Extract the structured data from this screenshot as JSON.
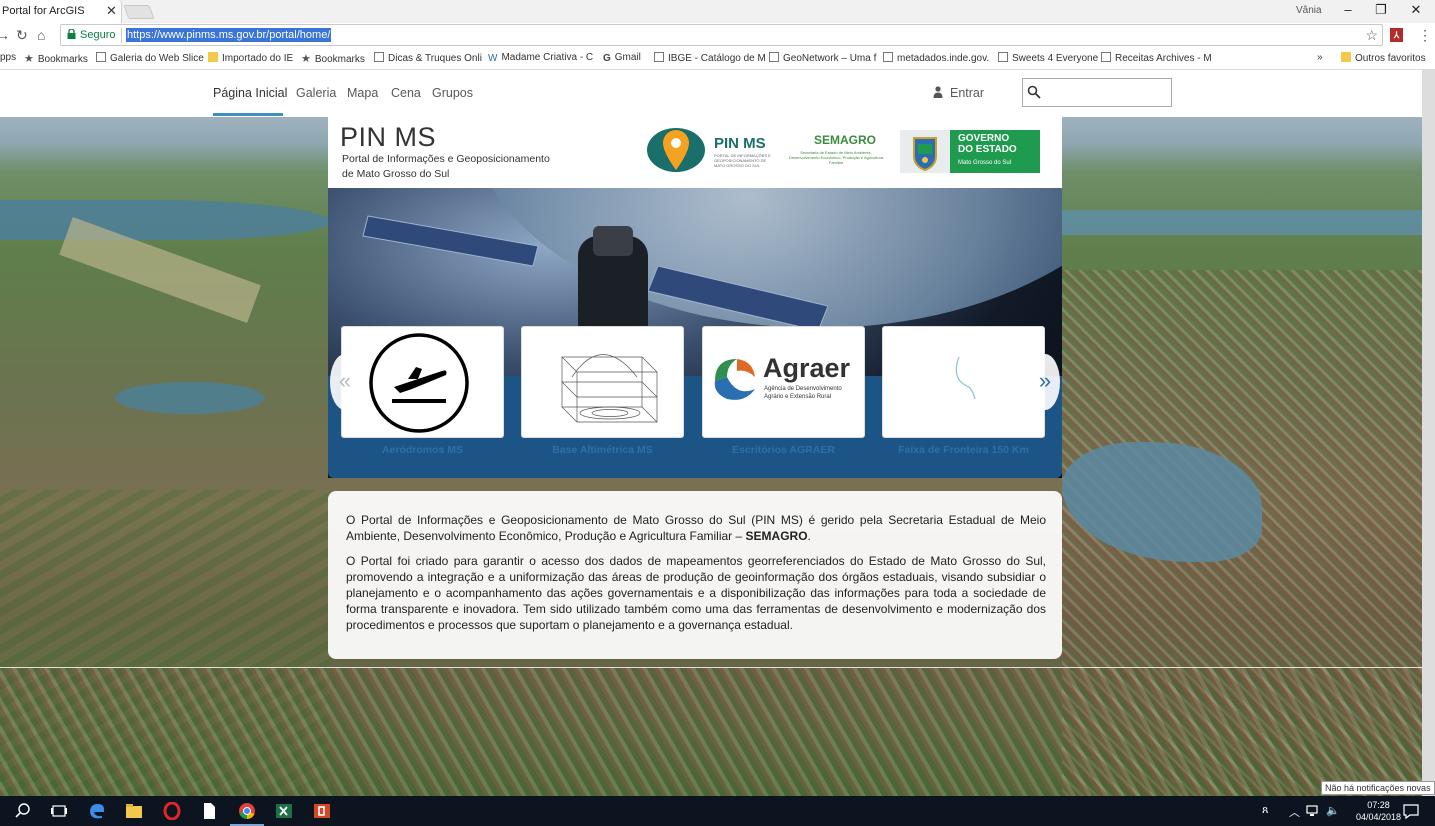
{
  "browser": {
    "tab_title": "Portal for ArcGIS",
    "user": "Vânia",
    "secure_label": "Seguro",
    "url": "https://www.pinms.ms.gov.br/portal/home/",
    "bookmarks": [
      "pps",
      "Bookmarks",
      "Galeria do Web Slice",
      "Importado do IE",
      "Bookmarks",
      "Dicas & Truques Onli",
      "Madame Criativa - C",
      "Gmail",
      "IBGE - Catálogo de M",
      "GeoNetwork – Uma f",
      "metadados.inde.gov.",
      "Sweets 4 Everyone",
      "Receitas Archives - M"
    ],
    "overflow": "»",
    "other_bookmarks": "Outros favoritos"
  },
  "nav": {
    "items": [
      "Página Inicial",
      "Galeria",
      "Mapa",
      "Cena",
      "Grupos"
    ],
    "signin": "Entrar",
    "search_placeholder": ""
  },
  "banner": {
    "title": "PIN MS",
    "subtitle_line1": "Portal de Informações e Geoposicionamento",
    "subtitle_line2": "de Mato Grosso do Sul",
    "logo_pin": "PIN MS",
    "logo_pin_small": "PORTAL DE INFORMAÇÕES E GEOPOSICIONAMENTO DE MATO GROSSO DO SUL",
    "logo_semagro": "SEMAGRO",
    "logo_semagro_small": "Secretaria de Estado de Meio Ambiente, Desenvolvimento Econômico, Produção e Agricultura Familiar",
    "gov_line1": "GOVERNO",
    "gov_line2": "DO ESTADO",
    "gov_line3": "Mato Grosso do Sul"
  },
  "carousel": {
    "prev": "«",
    "next": "»",
    "cards": [
      {
        "label": "Aeródromos MS"
      },
      {
        "label": "Base Altimétrica MS"
      },
      {
        "label": "Escritórios AGRAER",
        "brand": "Agraer",
        "brand_sub1": "Agência de Desenvolvimento",
        "brand_sub2": "Agrário e Extensão Rural"
      },
      {
        "label": "Faixa de Fronteira 150 Km"
      }
    ]
  },
  "about": {
    "p1_a": "O Portal de Informações e Geoposicionamento de Mato Grosso do Sul (PIN MS) é gerido pela Secretaria Estadual de Meio Ambiente, Desenvolvimento Econômico, Produção e Agricultura Familiar – ",
    "p1_b": "SEMAGRO",
    "p1_c": ".",
    "p2": "O Portal foi criado para garantir o acesso dos dados de mapeamentos georreferenciados do Estado de Mato Grosso do Sul, promovendo a integração e a uniformização das áreas de produção de geoinformação dos órgãos estaduais, visando subsidiar o planejamento e o acompanhamento das ações governamentais e a disponibilização das informações para toda a sociedade de forma transparente e inovadora. Tem sido utilizado também como uma das ferramentas de desenvolvimento e modernização dos procedimentos e processos que suportam o planejamento e a governança estadual."
  },
  "os": {
    "notification": "Não há notificações novas",
    "time": "07:28",
    "date": "04/04/2018"
  },
  "colors": {
    "accent": "#3f8fbf",
    "carousel_band": "#1d5486",
    "card_label": "#2f6fa8",
    "gov_green": "#1e9b4e"
  }
}
